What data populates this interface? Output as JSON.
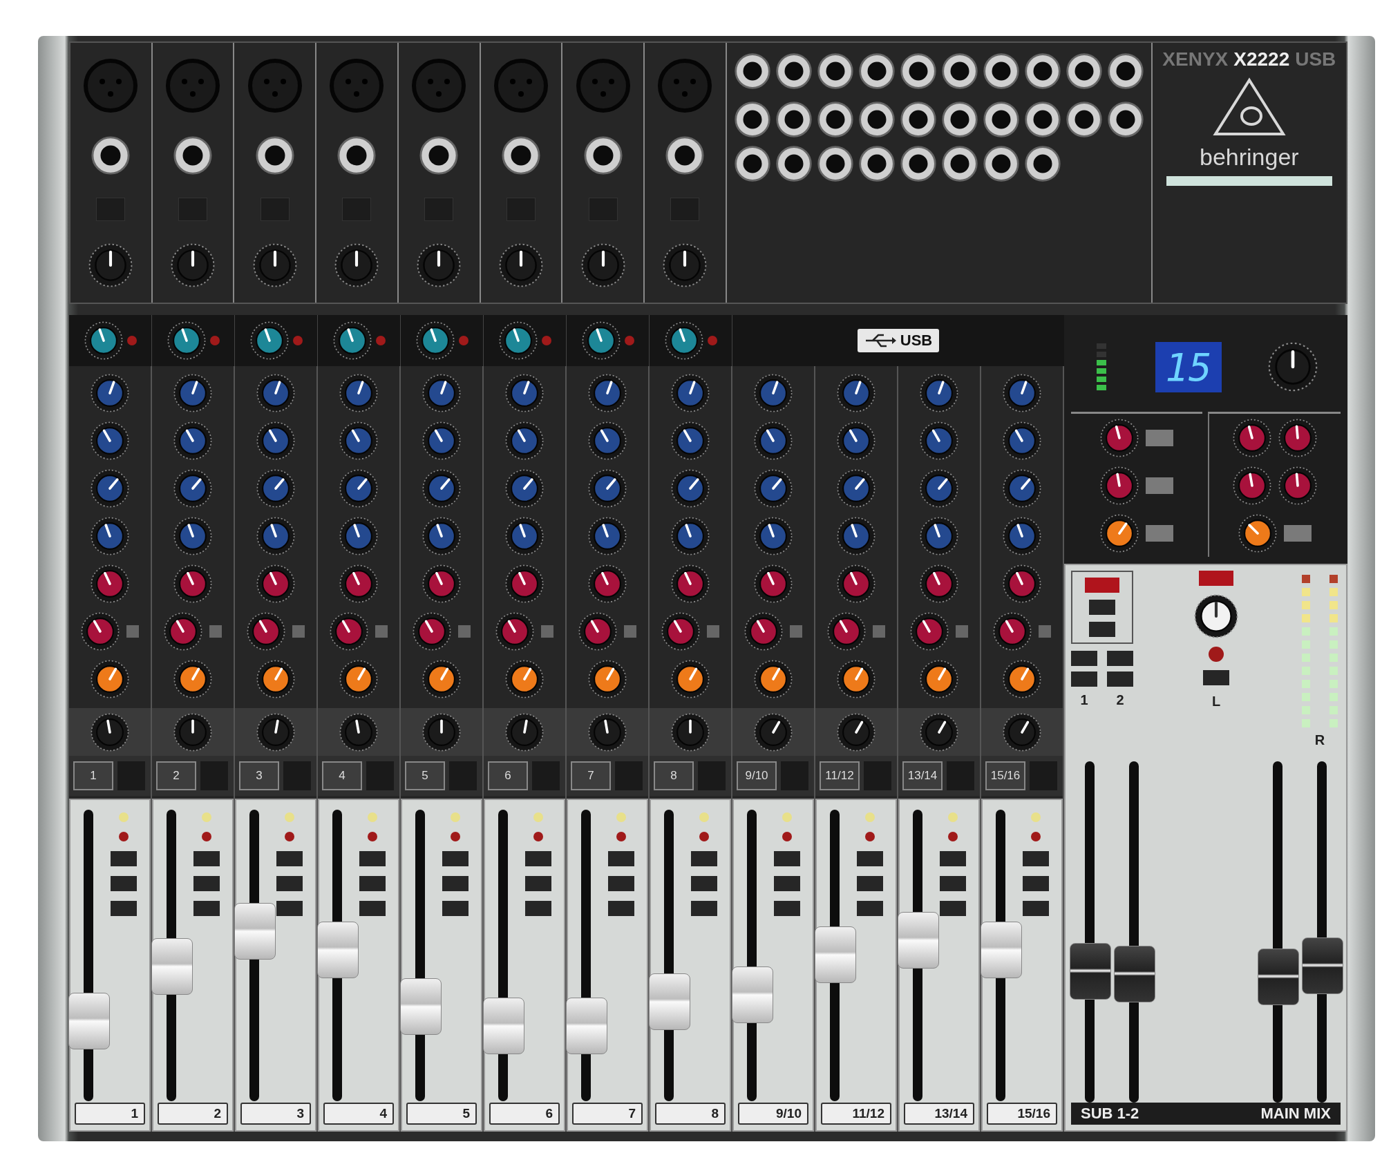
{
  "brand": {
    "series": "XENYX",
    "model": "X2222",
    "suffix": "USB",
    "maker": "behringer"
  },
  "usb_badge": "USB",
  "channels": [
    {
      "kind": "mono",
      "number": "1",
      "label": "1",
      "level": 0.22
    },
    {
      "kind": "mono",
      "number": "2",
      "label": "2",
      "level": 0.45
    },
    {
      "kind": "mono",
      "number": "3",
      "label": "3",
      "level": 0.6
    },
    {
      "kind": "mono",
      "number": "4",
      "label": "4",
      "level": 0.52
    },
    {
      "kind": "mono",
      "number": "5",
      "label": "5",
      "level": 0.28
    },
    {
      "kind": "mono",
      "number": "6",
      "label": "6",
      "level": 0.2
    },
    {
      "kind": "mono",
      "number": "7",
      "label": "7",
      "level": 0.2
    },
    {
      "kind": "mono",
      "number": "8",
      "label": "8",
      "level": 0.3
    },
    {
      "kind": "stereo",
      "number": "9/10",
      "label": "9/10",
      "level": 0.33
    },
    {
      "kind": "stereo",
      "number": "11/12",
      "label": "11/12",
      "level": 0.5
    },
    {
      "kind": "stereo",
      "number": "13/14",
      "label": "13/14",
      "level": 0.56
    },
    {
      "kind": "stereo",
      "number": "15/16",
      "label": "15/16",
      "level": 0.52
    }
  ],
  "fx_display": "15",
  "sub": {
    "numbers": [
      "1",
      "2"
    ],
    "label": "SUB 1-2",
    "faders": [
      {
        "level": 0.36
      },
      {
        "level": 0.35
      }
    ]
  },
  "main": {
    "left": "L",
    "right": "R",
    "label": "MAIN MIX",
    "faders": [
      {
        "level": 0.34
      },
      {
        "level": 0.38
      }
    ]
  }
}
